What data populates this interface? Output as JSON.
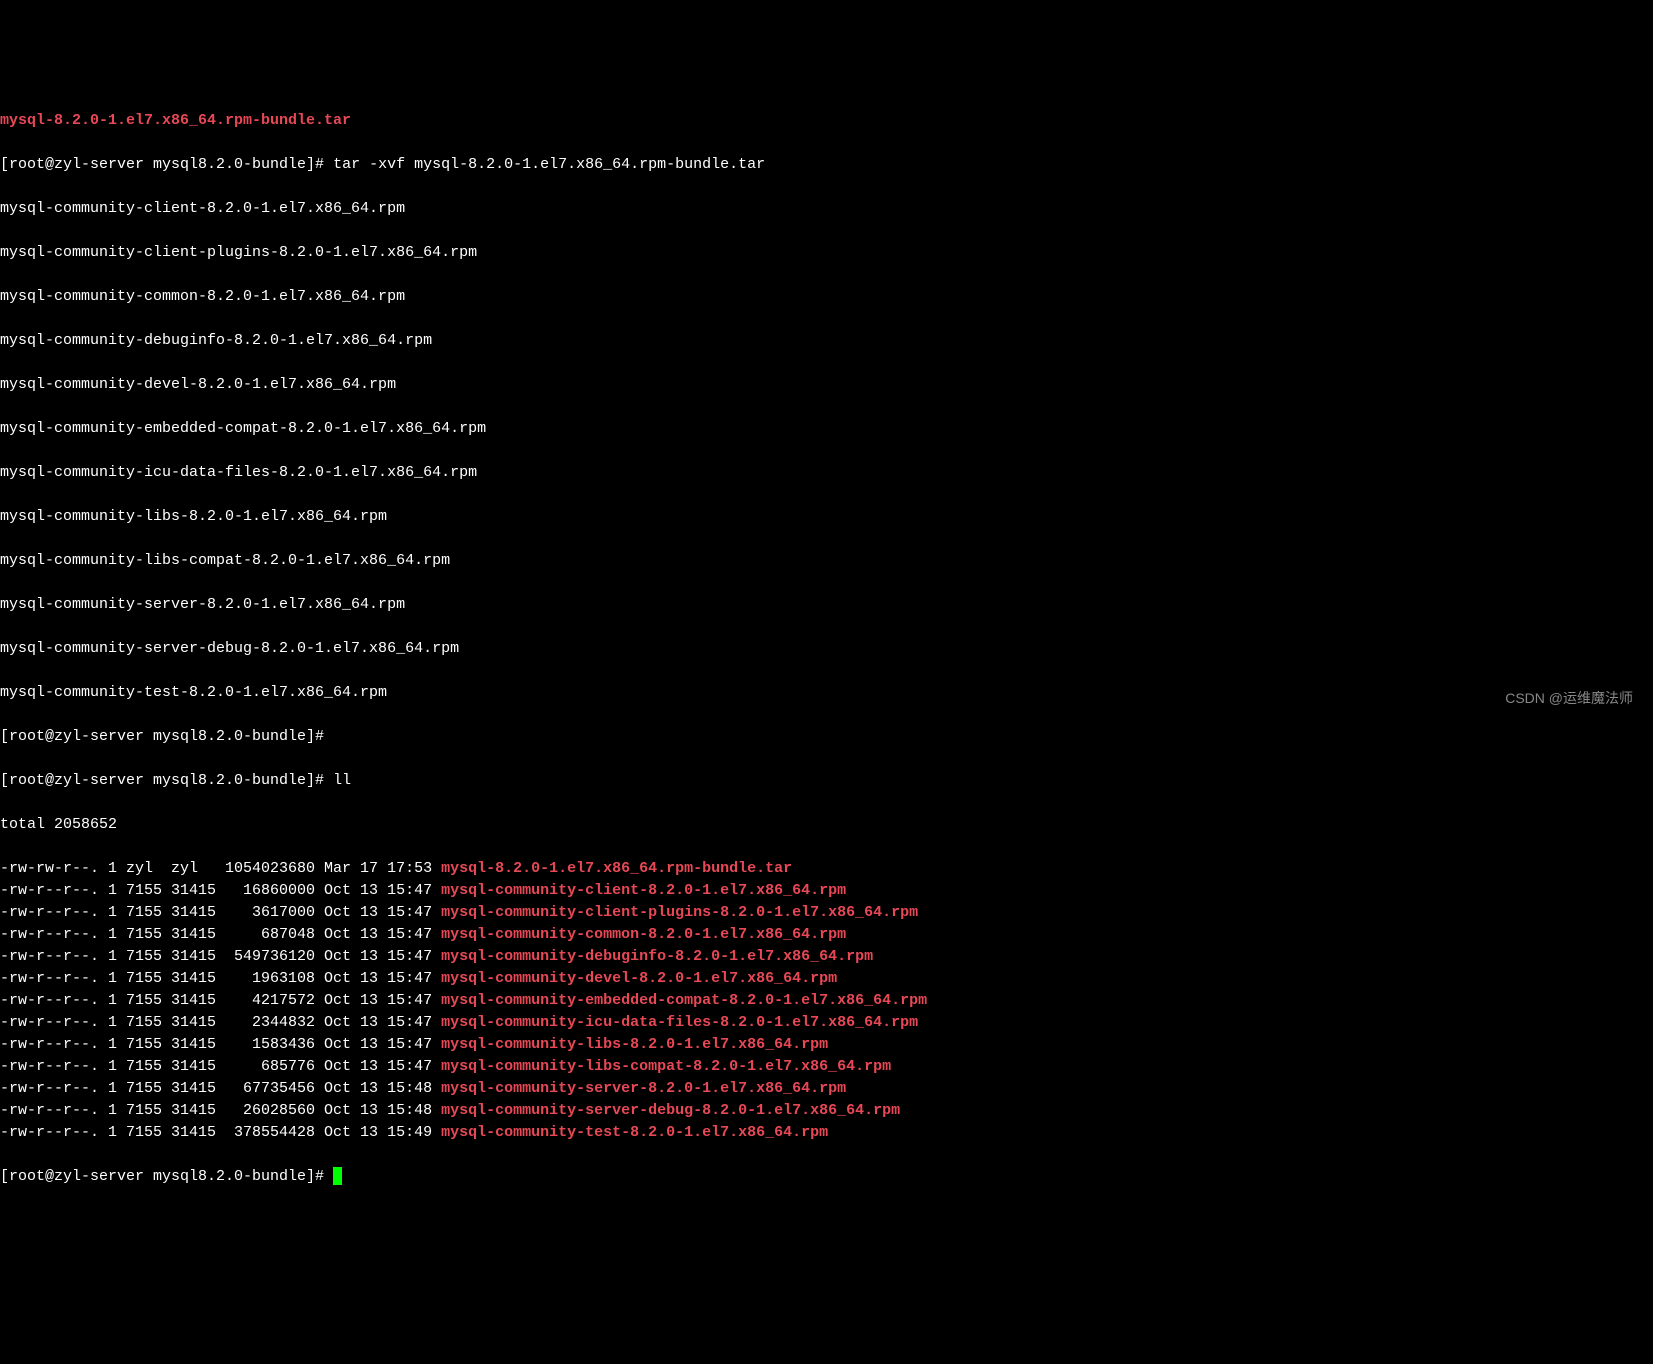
{
  "lines": {
    "line0_red": "mysql-8.2.0-1.el7.x86_64.rpm-bundle.tar",
    "prompt1": "[root@zyl-server mysql8.2.0-bundle]# ",
    "cmd1": "tar -xvf mysql-8.2.0-1.el7.x86_64.rpm-bundle.tar",
    "extract1": "mysql-community-client-8.2.0-1.el7.x86_64.rpm",
    "extract2": "mysql-community-client-plugins-8.2.0-1.el7.x86_64.rpm",
    "extract3": "mysql-community-common-8.2.0-1.el7.x86_64.rpm",
    "extract4": "mysql-community-debuginfo-8.2.0-1.el7.x86_64.rpm",
    "extract5": "mysql-community-devel-8.2.0-1.el7.x86_64.rpm",
    "extract6": "mysql-community-embedded-compat-8.2.0-1.el7.x86_64.rpm",
    "extract7": "mysql-community-icu-data-files-8.2.0-1.el7.x86_64.rpm",
    "extract8": "mysql-community-libs-8.2.0-1.el7.x86_64.rpm",
    "extract9": "mysql-community-libs-compat-8.2.0-1.el7.x86_64.rpm",
    "extract10": "mysql-community-server-8.2.0-1.el7.x86_64.rpm",
    "extract11": "mysql-community-server-debug-8.2.0-1.el7.x86_64.rpm",
    "extract12": "mysql-community-test-8.2.0-1.el7.x86_64.rpm",
    "prompt2": "[root@zyl-server mysql8.2.0-bundle]# ",
    "prompt3": "[root@zyl-server mysql8.2.0-bundle]# ",
    "cmd3": "ll",
    "total": "total 2058652"
  },
  "ls_entries": [
    {
      "perm": "-rw-rw-r--. 1 zyl  zyl   1054023680 Mar 17 17:53 ",
      "fname": "mysql-8.2.0-1.el7.x86_64.rpm-bundle.tar"
    },
    {
      "perm": "-rw-r--r--. 1 7155 31415   16860000 Oct 13 15:47 ",
      "fname": "mysql-community-client-8.2.0-1.el7.x86_64.rpm"
    },
    {
      "perm": "-rw-r--r--. 1 7155 31415    3617000 Oct 13 15:47 ",
      "fname": "mysql-community-client-plugins-8.2.0-1.el7.x86_64.rpm"
    },
    {
      "perm": "-rw-r--r--. 1 7155 31415     687048 Oct 13 15:47 ",
      "fname": "mysql-community-common-8.2.0-1.el7.x86_64.rpm"
    },
    {
      "perm": "-rw-r--r--. 1 7155 31415  549736120 Oct 13 15:47 ",
      "fname": "mysql-community-debuginfo-8.2.0-1.el7.x86_64.rpm"
    },
    {
      "perm": "-rw-r--r--. 1 7155 31415    1963108 Oct 13 15:47 ",
      "fname": "mysql-community-devel-8.2.0-1.el7.x86_64.rpm"
    },
    {
      "perm": "-rw-r--r--. 1 7155 31415    4217572 Oct 13 15:47 ",
      "fname": "mysql-community-embedded-compat-8.2.0-1.el7.x86_64.rpm"
    },
    {
      "perm": "-rw-r--r--. 1 7155 31415    2344832 Oct 13 15:47 ",
      "fname": "mysql-community-icu-data-files-8.2.0-1.el7.x86_64.rpm"
    },
    {
      "perm": "-rw-r--r--. 1 7155 31415    1583436 Oct 13 15:47 ",
      "fname": "mysql-community-libs-8.2.0-1.el7.x86_64.rpm"
    },
    {
      "perm": "-rw-r--r--. 1 7155 31415     685776 Oct 13 15:47 ",
      "fname": "mysql-community-libs-compat-8.2.0-1.el7.x86_64.rpm"
    },
    {
      "perm": "-rw-r--r--. 1 7155 31415   67735456 Oct 13 15:48 ",
      "fname": "mysql-community-server-8.2.0-1.el7.x86_64.rpm"
    },
    {
      "perm": "-rw-r--r--. 1 7155 31415   26028560 Oct 13 15:48 ",
      "fname": "mysql-community-server-debug-8.2.0-1.el7.x86_64.rpm"
    },
    {
      "perm": "-rw-r--r--. 1 7155 31415  378554428 Oct 13 15:49 ",
      "fname": "mysql-community-test-8.2.0-1.el7.x86_64.rpm"
    }
  ],
  "prompt_final": "[root@zyl-server mysql8.2.0-bundle]# ",
  "watermark": "CSDN @运维魔法师"
}
